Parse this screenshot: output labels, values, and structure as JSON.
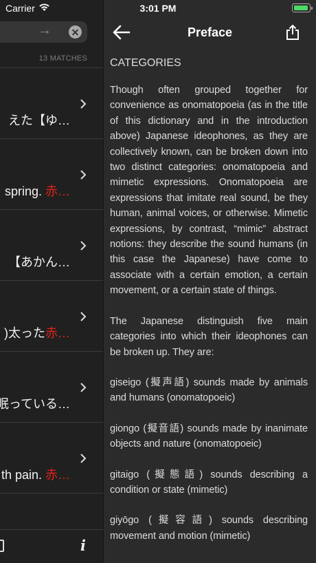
{
  "status_bar": {
    "carrier": "Carrier",
    "time": "3:01 PM",
    "icons": [
      "wifi-icon",
      "battery-icon"
    ],
    "battery_color": "#4cd964"
  },
  "search_panel": {
    "match_count": "13 MATCHES",
    "results": [
      {
        "text_before": "えた【ゆ…",
        "text_red": ""
      },
      {
        "text_before": "spring. ",
        "text_red": "赤…"
      },
      {
        "text_before": "【あかん…",
        "text_red": ""
      },
      {
        "text_before": ")太った",
        "text_red": "赤…"
      },
      {
        "text_before": "眠っている…",
        "text_red": ""
      },
      {
        "text_before": "th pain. ",
        "text_red": "赤…"
      }
    ],
    "highlight_color": "#e2231a",
    "toolbar_icons": [
      "document-icon",
      "info-icon"
    ],
    "info_label": "i"
  },
  "document": {
    "title": "Preface",
    "heading": "CATEGORIES",
    "paragraphs": [
      "Though often grouped together for convenience as onomatopoeia (as in the title of this dictionary and in the introduction above) Japanese ideophones, as they are collectively known, can be broken down into two distinct categories: onomatopoeia and mimetic expressions. Onomatopoeia are expressions that imitate real sound, be they human, animal voices, or otherwise. Mimetic expressions, by contrast, “mimic” abstract notions: they describe the sound humans (in this case the Japanese) have come to associate with a certain emotion, a certain movement, or a certain state of things.",
      "The Japanese distinguish five main categories into which their ideophones can be broken up. They are:",
      "giseigo (擬声語) sounds made by animals and humans (onomatopoeic)",
      "giongo (擬音語) sounds made by inanimate objects and nature (onomatopoeic)",
      "gitaigo (擬態語) sounds describing a condition or state (mimetic)",
      "giyōgo (擬容語) sounds describing movement and motion (mimetic)"
    ]
  }
}
